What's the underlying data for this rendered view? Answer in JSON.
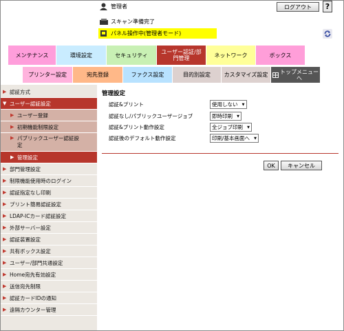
{
  "header": {
    "user": "管理者",
    "status": "スキャン準備完了",
    "banner": "パネル操作中(管理者モード)",
    "logout_label": "ログアウト",
    "help_label": "?"
  },
  "tabs": [
    {
      "label": "メンテナンス",
      "color": "#ff9edb"
    },
    {
      "label": "環境設定",
      "color": "#c9ecff"
    },
    {
      "label": "セキュリティ",
      "color": "#c8f0b4"
    },
    {
      "label": "ユーザー認証/部\n門管理",
      "color": "#b7362c",
      "active": true
    },
    {
      "label": "ネットワーク",
      "color": "#ffff99"
    },
    {
      "label": "ボックス",
      "color": "#ff9ed9"
    }
  ],
  "subtabs": [
    {
      "label": "プリンター設定",
      "color": "#ffb3dd"
    },
    {
      "label": "宛先登録",
      "color": "#ffb888"
    },
    {
      "label": "ファクス設定",
      "color": "#b8e2ff"
    },
    {
      "label": "目的別設定",
      "color": "#ddd1cf"
    },
    {
      "label": "カスタマイズ設定",
      "color": "#ddd1cf"
    },
    {
      "label": "トップメニュー\nへ",
      "color": "#555555"
    }
  ],
  "sidebar": {
    "items": [
      {
        "label": "認証方式"
      },
      {
        "label": "ユーザー認証設定"
      },
      {
        "label": "ユーザー登録"
      },
      {
        "label": "初期機能制限設定"
      },
      {
        "label": "パブリックユーザー認証設\n定"
      },
      {
        "label": "管理設定"
      },
      {
        "label": "部門管理設定"
      },
      {
        "label": "制限機能使用時のログイン"
      },
      {
        "label": "認証指定なし印刷"
      },
      {
        "label": "プリント簡易認証設定"
      },
      {
        "label": "LDAP-ICカード認証設定"
      },
      {
        "label": "外部サーバー設定"
      },
      {
        "label": "認証装置設定"
      },
      {
        "label": "共有ボックス設定"
      },
      {
        "label": "ユーザー/部門共通設定"
      },
      {
        "label": "Home宛先有効設定"
      },
      {
        "label": "送信宛先制限"
      },
      {
        "label": "認証カードIDの通知"
      },
      {
        "label": "遠隔カウンター管理"
      }
    ]
  },
  "content": {
    "title": "管理設定",
    "rows": [
      {
        "label": "認証&プリント",
        "value": "使用しない"
      },
      {
        "label": "認証なし/パブリックユーザージョブ",
        "value": "即時印刷"
      },
      {
        "label": "認証&プリント動作設定",
        "value": "全ジョブ印刷"
      },
      {
        "label": "認証後のデフォルト動作設定",
        "value": "印刷/基本画面へ"
      }
    ],
    "ok_label": "OK",
    "cancel_label": "キャンセル"
  },
  "colors": {
    "accent": "#b7362c",
    "sidebar_bg": "#ece8e2",
    "sub_bg": "#d4b1a6"
  },
  "icons": [
    "user-icon",
    "scanner-icon",
    "panel-icon",
    "refresh-icon",
    "help-icon",
    "top-menu-icon"
  ]
}
